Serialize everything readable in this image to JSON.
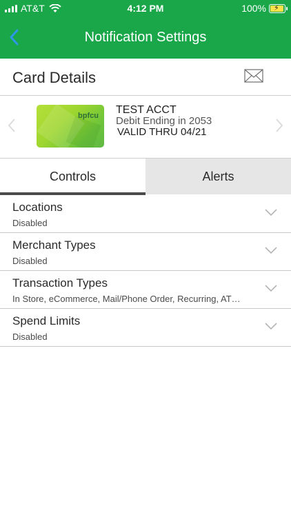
{
  "status_bar": {
    "carrier": "AT&T",
    "time": "4:12 PM",
    "battery": "100%"
  },
  "nav": {
    "title": "Notification Settings",
    "back_icon": "chevron-left-icon"
  },
  "card_header": {
    "label": "Card Details",
    "mail_icon": "envelope-icon"
  },
  "card": {
    "brand": "bpfcu",
    "name": "TEST ACCT",
    "description": "Debit Ending in 2053",
    "valid_thru": "VALID THRU 04/21"
  },
  "tabs": [
    {
      "label": "Controls",
      "active": true
    },
    {
      "label": "Alerts",
      "active": false
    }
  ],
  "controls": [
    {
      "title": "Locations",
      "value": "Disabled"
    },
    {
      "title": "Merchant Types",
      "value": "Disabled"
    },
    {
      "title": "Transaction Types",
      "value": "In Store, eCommerce, Mail/Phone Order, Recurring, AT…"
    },
    {
      "title": "Spend Limits",
      "value": "Disabled"
    }
  ],
  "colors": {
    "brand_green": "#19a74a",
    "tab_inactive_bg": "#e6e6e6",
    "tab_indicator": "#4a4a4a"
  }
}
